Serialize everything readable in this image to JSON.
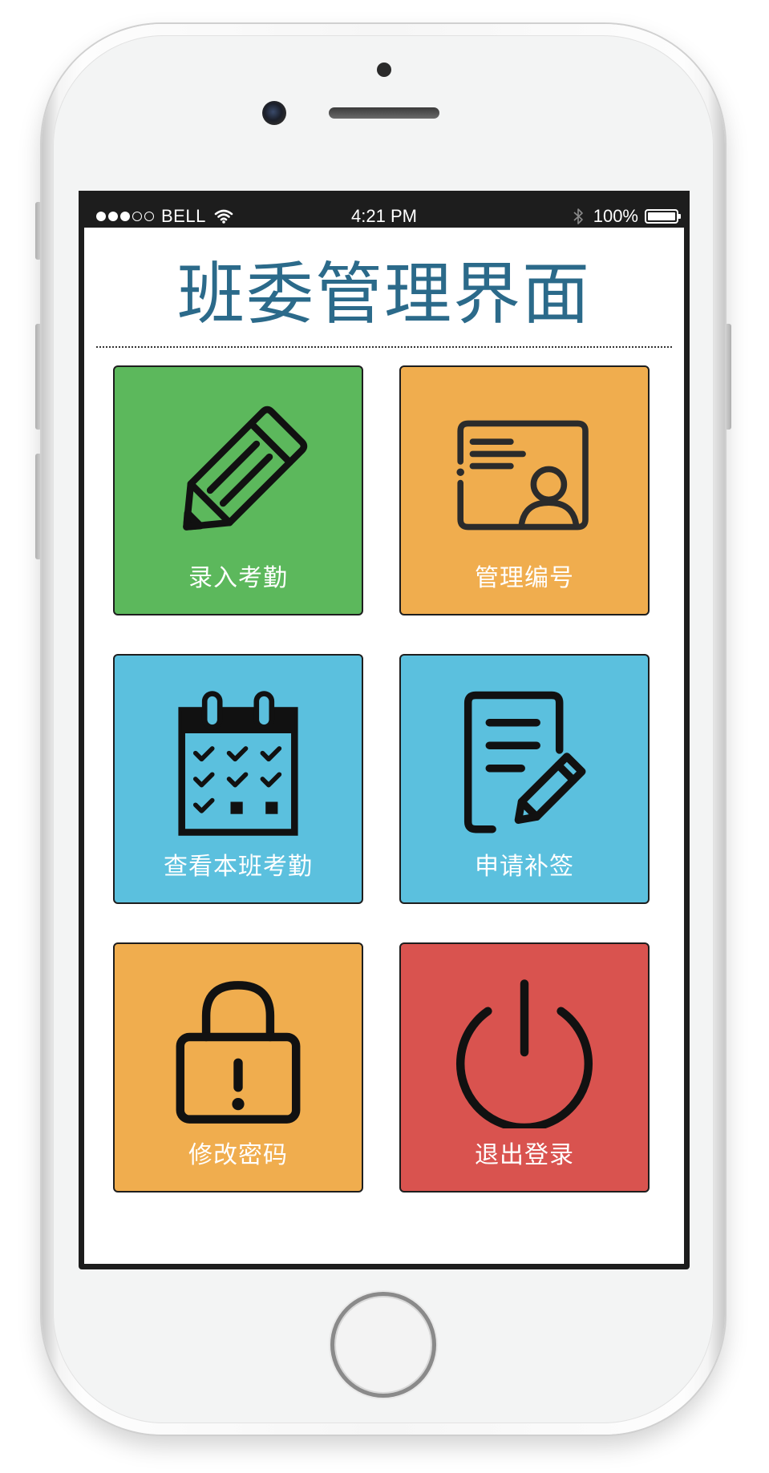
{
  "status_bar": {
    "signal_strength": "3 of 5",
    "carrier": "BELL",
    "time": "4:21 PM",
    "battery_percent": "100%",
    "battery_level": 1.0
  },
  "page": {
    "title": "班委管理界面"
  },
  "tiles": [
    {
      "label": "录入考勤",
      "color": "#5cb85c",
      "icon": "pencil-icon"
    },
    {
      "label": "管理编号",
      "color": "#f0ad4e",
      "icon": "id-card-icon"
    },
    {
      "label": "查看本班考勤",
      "color": "#5bc0de",
      "icon": "calendar-check-icon"
    },
    {
      "label": "申请补签",
      "color": "#5bc0de",
      "icon": "document-edit-icon"
    },
    {
      "label": "修改密码",
      "color": "#f0ad4e",
      "icon": "lock-alert-icon"
    },
    {
      "label": "退出登录",
      "color": "#d9534f",
      "icon": "power-icon"
    }
  ],
  "theme": {
    "title_color": "#2b6a8a",
    "status_bar_bg": "#1d1d1d"
  }
}
